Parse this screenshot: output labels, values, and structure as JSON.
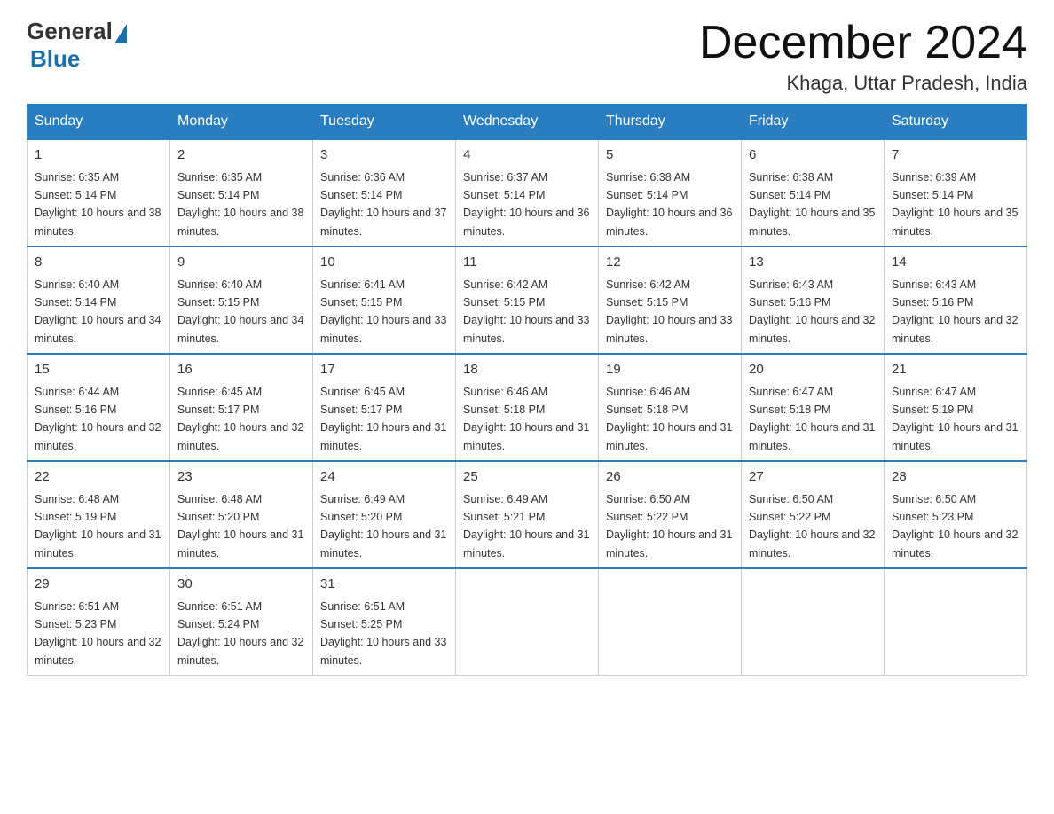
{
  "logo": {
    "general": "General",
    "blue": "Blue"
  },
  "title": "December 2024",
  "location": "Khaga, Uttar Pradesh, India",
  "headers": [
    "Sunday",
    "Monday",
    "Tuesday",
    "Wednesday",
    "Thursday",
    "Friday",
    "Saturday"
  ],
  "weeks": [
    [
      {
        "day": "1",
        "sunrise": "6:35 AM",
        "sunset": "5:14 PM",
        "daylight": "10 hours and 38 minutes."
      },
      {
        "day": "2",
        "sunrise": "6:35 AM",
        "sunset": "5:14 PM",
        "daylight": "10 hours and 38 minutes."
      },
      {
        "day": "3",
        "sunrise": "6:36 AM",
        "sunset": "5:14 PM",
        "daylight": "10 hours and 37 minutes."
      },
      {
        "day": "4",
        "sunrise": "6:37 AM",
        "sunset": "5:14 PM",
        "daylight": "10 hours and 36 minutes."
      },
      {
        "day": "5",
        "sunrise": "6:38 AM",
        "sunset": "5:14 PM",
        "daylight": "10 hours and 36 minutes."
      },
      {
        "day": "6",
        "sunrise": "6:38 AM",
        "sunset": "5:14 PM",
        "daylight": "10 hours and 35 minutes."
      },
      {
        "day": "7",
        "sunrise": "6:39 AM",
        "sunset": "5:14 PM",
        "daylight": "10 hours and 35 minutes."
      }
    ],
    [
      {
        "day": "8",
        "sunrise": "6:40 AM",
        "sunset": "5:14 PM",
        "daylight": "10 hours and 34 minutes."
      },
      {
        "day": "9",
        "sunrise": "6:40 AM",
        "sunset": "5:15 PM",
        "daylight": "10 hours and 34 minutes."
      },
      {
        "day": "10",
        "sunrise": "6:41 AM",
        "sunset": "5:15 PM",
        "daylight": "10 hours and 33 minutes."
      },
      {
        "day": "11",
        "sunrise": "6:42 AM",
        "sunset": "5:15 PM",
        "daylight": "10 hours and 33 minutes."
      },
      {
        "day": "12",
        "sunrise": "6:42 AM",
        "sunset": "5:15 PM",
        "daylight": "10 hours and 33 minutes."
      },
      {
        "day": "13",
        "sunrise": "6:43 AM",
        "sunset": "5:16 PM",
        "daylight": "10 hours and 32 minutes."
      },
      {
        "day": "14",
        "sunrise": "6:43 AM",
        "sunset": "5:16 PM",
        "daylight": "10 hours and 32 minutes."
      }
    ],
    [
      {
        "day": "15",
        "sunrise": "6:44 AM",
        "sunset": "5:16 PM",
        "daylight": "10 hours and 32 minutes."
      },
      {
        "day": "16",
        "sunrise": "6:45 AM",
        "sunset": "5:17 PM",
        "daylight": "10 hours and 32 minutes."
      },
      {
        "day": "17",
        "sunrise": "6:45 AM",
        "sunset": "5:17 PM",
        "daylight": "10 hours and 31 minutes."
      },
      {
        "day": "18",
        "sunrise": "6:46 AM",
        "sunset": "5:18 PM",
        "daylight": "10 hours and 31 minutes."
      },
      {
        "day": "19",
        "sunrise": "6:46 AM",
        "sunset": "5:18 PM",
        "daylight": "10 hours and 31 minutes."
      },
      {
        "day": "20",
        "sunrise": "6:47 AM",
        "sunset": "5:18 PM",
        "daylight": "10 hours and 31 minutes."
      },
      {
        "day": "21",
        "sunrise": "6:47 AM",
        "sunset": "5:19 PM",
        "daylight": "10 hours and 31 minutes."
      }
    ],
    [
      {
        "day": "22",
        "sunrise": "6:48 AM",
        "sunset": "5:19 PM",
        "daylight": "10 hours and 31 minutes."
      },
      {
        "day": "23",
        "sunrise": "6:48 AM",
        "sunset": "5:20 PM",
        "daylight": "10 hours and 31 minutes."
      },
      {
        "day": "24",
        "sunrise": "6:49 AM",
        "sunset": "5:20 PM",
        "daylight": "10 hours and 31 minutes."
      },
      {
        "day": "25",
        "sunrise": "6:49 AM",
        "sunset": "5:21 PM",
        "daylight": "10 hours and 31 minutes."
      },
      {
        "day": "26",
        "sunrise": "6:50 AM",
        "sunset": "5:22 PM",
        "daylight": "10 hours and 31 minutes."
      },
      {
        "day": "27",
        "sunrise": "6:50 AM",
        "sunset": "5:22 PM",
        "daylight": "10 hours and 32 minutes."
      },
      {
        "day": "28",
        "sunrise": "6:50 AM",
        "sunset": "5:23 PM",
        "daylight": "10 hours and 32 minutes."
      }
    ],
    [
      {
        "day": "29",
        "sunrise": "6:51 AM",
        "sunset": "5:23 PM",
        "daylight": "10 hours and 32 minutes."
      },
      {
        "day": "30",
        "sunrise": "6:51 AM",
        "sunset": "5:24 PM",
        "daylight": "10 hours and 32 minutes."
      },
      {
        "day": "31",
        "sunrise": "6:51 AM",
        "sunset": "5:25 PM",
        "daylight": "10 hours and 33 minutes."
      },
      null,
      null,
      null,
      null
    ]
  ]
}
